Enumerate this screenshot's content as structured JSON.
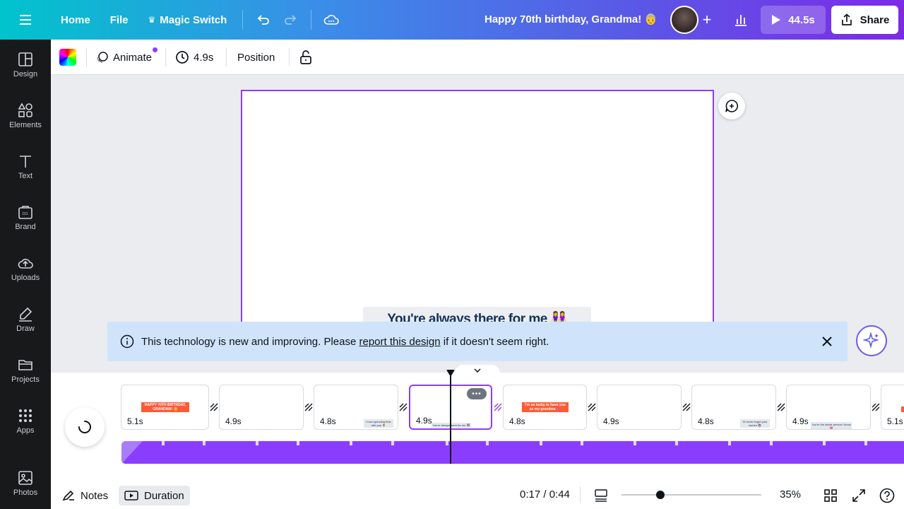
{
  "topbar": {
    "home": "Home",
    "file": "File",
    "magic_switch": "Magic Switch",
    "doc_title": "Happy 70th birthday, Grandma! 👵",
    "play_duration": "44.5s",
    "share": "Share"
  },
  "sidebar": {
    "items": [
      {
        "label": "Design",
        "icon": "design-icon"
      },
      {
        "label": "Elements",
        "icon": "elements-icon"
      },
      {
        "label": "Text",
        "icon": "text-icon"
      },
      {
        "label": "Brand",
        "icon": "brand-icon"
      },
      {
        "label": "Uploads",
        "icon": "uploads-icon"
      },
      {
        "label": "Draw",
        "icon": "draw-icon"
      },
      {
        "label": "Projects",
        "icon": "projects-icon"
      },
      {
        "label": "Apps",
        "icon": "apps-icon"
      },
      {
        "label": "Photos",
        "icon": "photos-icon"
      }
    ]
  },
  "toolbar": {
    "animate": "Animate",
    "duration": "4.9s",
    "position": "Position"
  },
  "canvas": {
    "caption": "You're always there for me 👭"
  },
  "banner": {
    "text_before": "This technology is new and improving. Please ",
    "link": "report this design",
    "text_after": " if it doesn't seem right."
  },
  "timeline": {
    "pages": [
      {
        "duration": "5.1s",
        "mini_text": "HAPPY 70TH BIRTHDAY, GRANDMA! 👵"
      },
      {
        "duration": "4.9s",
        "mini_text": ""
      },
      {
        "duration": "4.8s",
        "mini_text": "I love spending time with you 🌻"
      },
      {
        "duration": "4.9s",
        "mini_text": "You're always there for me 👭"
      },
      {
        "duration": "4.8s",
        "mini_text": "I'm so lucky to have you as my grandma 💕"
      },
      {
        "duration": "4.9s",
        "mini_text": ""
      },
      {
        "duration": "4.8s",
        "mini_text": "I'll never forget your stories 📚"
      },
      {
        "duration": "4.9s",
        "mini_text": "You're the whole person I know 💖"
      },
      {
        "duration": "5.1s",
        "mini_text": ""
      }
    ]
  },
  "bottombar": {
    "notes": "Notes",
    "duration": "Duration",
    "time": "0:17 / 0:44",
    "zoom": "35%",
    "zoom_level": 0.28
  },
  "colors": {
    "accent": "#8b3dff",
    "sidebar_bg": "#18191b",
    "banner_bg": "#cfe4fb"
  }
}
